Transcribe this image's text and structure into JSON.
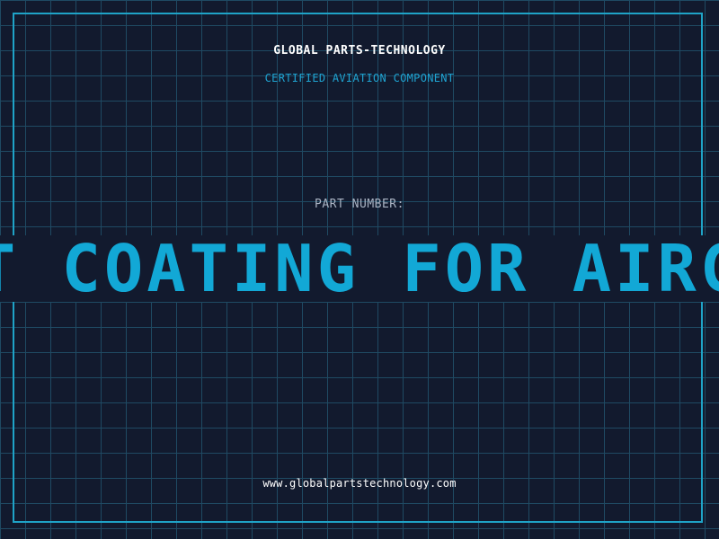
{
  "header": {
    "company": "GLOBAL PARTS-TECHNOLOGY",
    "tagline": "CERTIFIED AVIATION COMPONENT"
  },
  "part": {
    "label": "PART NUMBER:",
    "value": "PAINT COATING FOR AIRCRAFT"
  },
  "footer": {
    "url": "www.globalpartstechnology.com"
  },
  "colors": {
    "background": "#121a2e",
    "grid": "#1f4a63",
    "frame": "#1fa3c7",
    "accent": "#12a8d6"
  }
}
